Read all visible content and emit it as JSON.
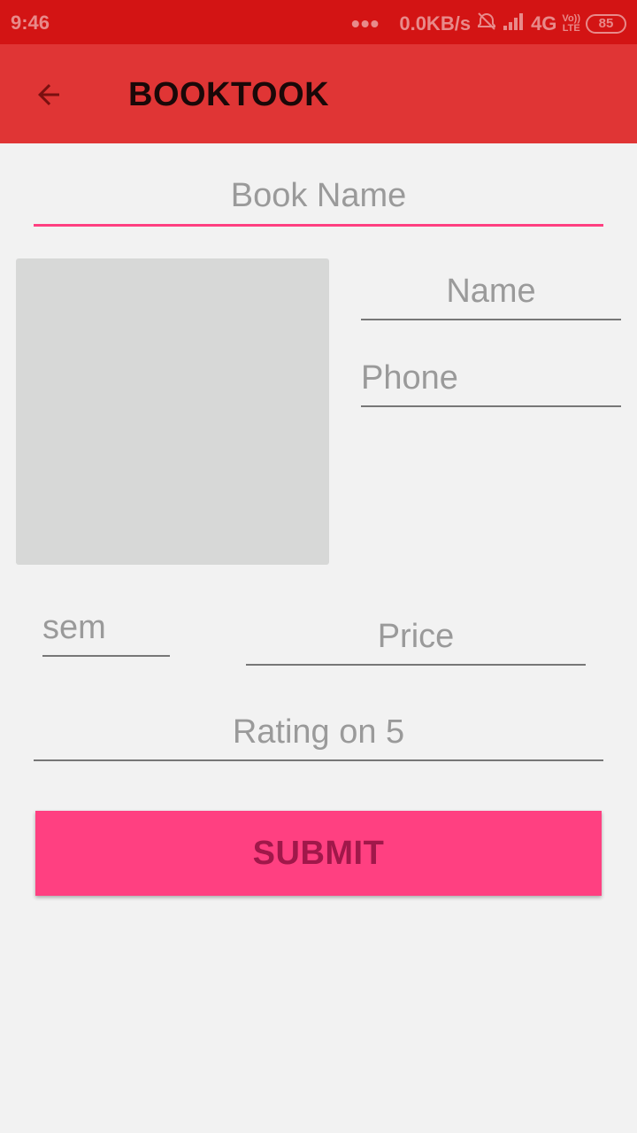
{
  "status_bar": {
    "time": "9:46",
    "dots": "•••",
    "speed": "0.0KB/s",
    "network": "4G",
    "volte_top": "Vo))",
    "volte_bottom": "LTE",
    "battery": "85"
  },
  "app_bar": {
    "title": "BOOKTOOK",
    "back_icon": "arrow-back-icon"
  },
  "form": {
    "book_name_placeholder": "Book Name",
    "name_placeholder": "Name",
    "phone_placeholder": "Phone",
    "sem_placeholder": "sem",
    "price_placeholder": "Price",
    "rating_placeholder": "Rating on 5",
    "submit_label": "SUBMIT"
  },
  "colors": {
    "status_bar": "#d31414",
    "app_bar": "#e03535",
    "accent": "#ff4081",
    "background": "#f2f2f2",
    "image_placeholder": "#d7d8d7"
  }
}
